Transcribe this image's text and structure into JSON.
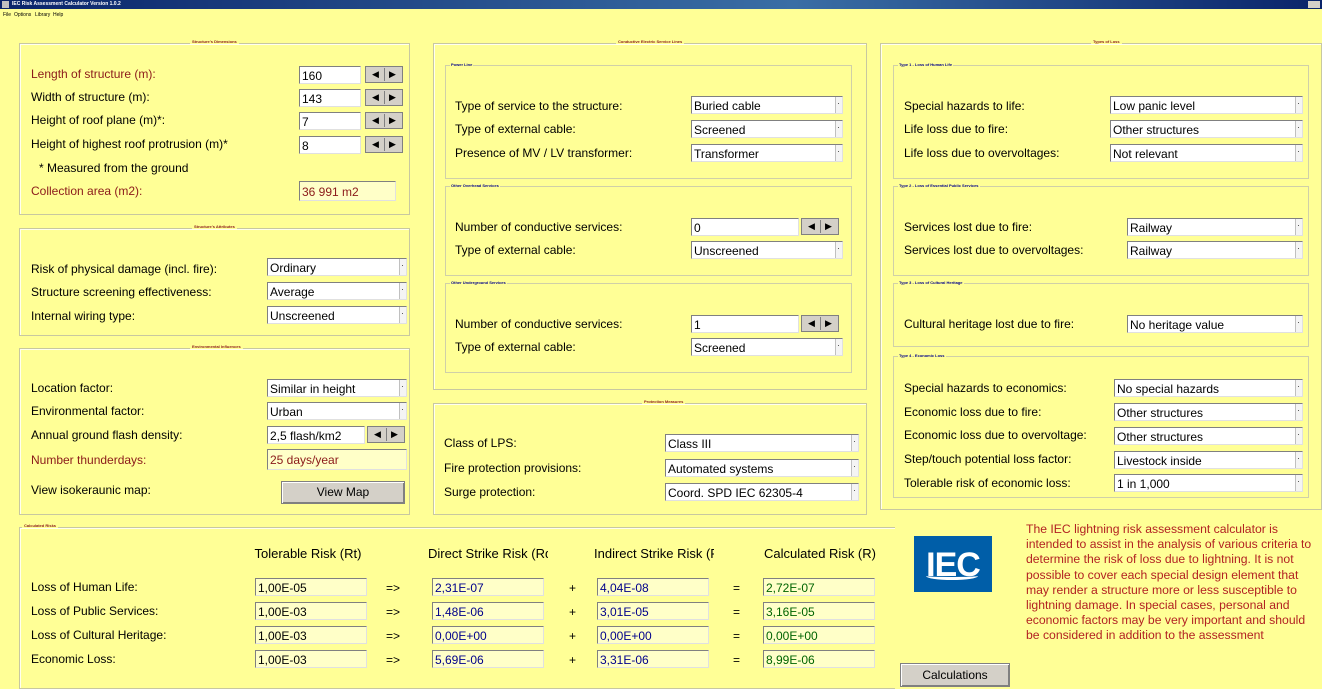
{
  "window": {
    "title": "IEC Risk Assessment Calculator Version 1.0.2"
  },
  "menu": [
    "File",
    "Options",
    "Library",
    "Help"
  ],
  "dimensions": {
    "group_title": "Structure's Dimensions",
    "length_label": "Length of structure (m):",
    "length_value": "160",
    "width_label": "Width of structure (m):",
    "width_value": "143",
    "roof_label": "Height of roof plane (m)*:",
    "roof_value": "7",
    "protrusion_label": "Height of highest roof protrusion (m)*",
    "protrusion_value": "8",
    "note": "* Measured from the ground",
    "area_label": "Collection area (m2):",
    "area_value": "36 991 m2"
  },
  "attributes": {
    "group_title": "Structure's Attributes",
    "risk_label": "Risk of physical damage (incl. fire):",
    "risk_value": "Ordinary",
    "screening_label": "Structure screening effectiveness:",
    "screening_value": "Average",
    "wiring_label": "Internal wiring type:",
    "wiring_value": "Unscreened"
  },
  "environment": {
    "group_title": "Environmental Influences",
    "location_label": "Location factor:",
    "location_value": "Similar in height",
    "env_label": "Environmental factor:",
    "env_value": "Urban",
    "flash_label": "Annual ground flash density:",
    "flash_value": "2,5 flash/km2",
    "thunder_label": "Number thunderdays:",
    "thunder_value": "25 days/year",
    "map_label": "View isokeraunic map:",
    "map_button": "View Map"
  },
  "services": {
    "group_title": "Conductive Electric Service Lines",
    "power_title": "Power Line",
    "service_type_label": "Type of service to the structure:",
    "service_type_value": "Buried cable",
    "ext_cable_label": "Type of external cable:",
    "ext_cable_value": "Screened",
    "transformer_label": "Presence of MV / LV transformer:",
    "transformer_value": "Transformer",
    "overhead_title": "Other Overhead Services",
    "oh_count_label": "Number of conductive services:",
    "oh_count_value": "0",
    "oh_cable_label": "Type of external cable:",
    "oh_cable_value": "Unscreened",
    "underground_title": "Other Underground Services",
    "ug_count_label": "Number of conductive services:",
    "ug_count_value": "1",
    "ug_cable_label": "Type of external cable:",
    "ug_cable_value": "Screened"
  },
  "protection": {
    "group_title": "Protection Measures",
    "lps_label": "Class of LPS:",
    "lps_value": "Class III",
    "fire_label": "Fire protection provisions:",
    "fire_value": "Automated systems",
    "surge_label": "Surge protection:",
    "surge_value": "Coord. SPD IEC 62305-4"
  },
  "loss": {
    "group_title": "Types of Loss",
    "t1_title": "Type 1 - Loss of Human Life",
    "hazards_label": "Special hazards to life:",
    "hazards_value": "Low panic level",
    "life_fire_label": "Life loss due to fire:",
    "life_fire_value": "Other structures",
    "life_ov_label": "Life loss due to overvoltages:",
    "life_ov_value": "Not relevant",
    "t2_title": "Type 2 - Loss of Essential Public Services",
    "svc_fire_label": "Services lost due to fire:",
    "svc_fire_value": "Railway",
    "svc_ov_label": "Services lost due to overvoltages:",
    "svc_ov_value": "Railway",
    "t3_title": "Type 3 - Loss of Cultural Heritage",
    "heritage_label": "Cultural heritage lost due to fire:",
    "heritage_value": "No heritage value",
    "t4_title": "Type 4 - Economic Loss",
    "eco_haz_label": "Special hazards to economics:",
    "eco_haz_value": "No special hazards",
    "eco_fire_label": "Economic loss due to fire:",
    "eco_fire_value": "Other structures",
    "eco_ov_label": "Economic loss due to overvoltage:",
    "eco_ov_value": "Other structures",
    "step_label": "Step/touch potential loss factor:",
    "step_value": "Livestock inside",
    "tolerable_label": "Tolerable risk of economic loss:",
    "tolerable_value": "1 in 1,000"
  },
  "risks": {
    "group_title": "Calculated Risks",
    "headers": [
      "Tolerable Risk (Rt)",
      "Direct Strike Risk (Rd)",
      "Indirect Strike Risk (Ri)",
      "Calculated Risk (R)"
    ],
    "rows": [
      {
        "label": "Loss of Human Life:",
        "rt": "1,00E-05",
        "rd": "2,31E-07",
        "ri": "4,04E-08",
        "r": "2,72E-07"
      },
      {
        "label": "Loss of Public Services:",
        "rt": "1,00E-03",
        "rd": "1,48E-06",
        "ri": "3,01E-05",
        "r": "3,16E-05"
      },
      {
        "label": "Loss of Cultural Heritage:",
        "rt": "1,00E-03",
        "rd": "0,00E+00",
        "ri": "0,00E+00",
        "r": "0,00E+00"
      },
      {
        "label": "Economic Loss:",
        "rt": "1,00E-03",
        "rd": "5,69E-06",
        "ri": "3,31E-06",
        "r": "8,99E-06"
      }
    ],
    "arrow": "=>",
    "plus": "+",
    "equals": "="
  },
  "logo_text": "IEC",
  "calc_button": "Calculations",
  "info_text": "The IEC lightning risk assessment calculator is intended to assist in the analysis of various criteria to determine the risk of loss due to lightning. It is not possible to cover each special design element that may render a structure more or less susceptible to lightning damage. In special cases, personal and economic factors may be very important and should be considered in addition to the assessment"
}
